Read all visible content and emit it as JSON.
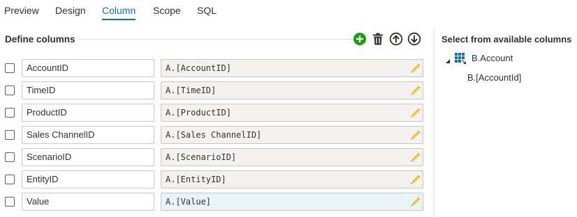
{
  "tabs": [
    {
      "label": "Preview"
    },
    {
      "label": "Design"
    },
    {
      "label": "Column",
      "active": true
    },
    {
      "label": "Scope"
    },
    {
      "label": "SQL"
    }
  ],
  "define": {
    "title": "Define columns",
    "toolbar": {
      "add_icon": "add-circle-icon",
      "delete_icon": "trash-icon",
      "move_up_icon": "arrow-up-circle-icon",
      "move_down_icon": "arrow-down-circle-icon"
    },
    "rows": [
      {
        "name": "AccountID",
        "expression": "A.[AccountID]"
      },
      {
        "name": "TimeID",
        "expression": "A.[TimeID]"
      },
      {
        "name": "ProductID",
        "expression": "A.[ProductID]"
      },
      {
        "name": "Sales ChannelID",
        "expression": "A.[Sales ChannelID]"
      },
      {
        "name": "ScenarioID",
        "expression": "A.[ScenarioID]"
      },
      {
        "name": "EntityID",
        "expression": "A.[EntityID]"
      },
      {
        "name": "Value",
        "expression": "A.[Value]",
        "selected": true
      }
    ]
  },
  "available": {
    "title": "Select from available columns",
    "tree": {
      "label": "B.Account",
      "expanded": true,
      "children": [
        {
          "label": "B.[AccountId]"
        }
      ]
    }
  },
  "colors": {
    "accent": "#0f6cbd",
    "add_green": "#13a10e",
    "pencil_yellow": "#f2c811",
    "selected_field": "#e8f4f8",
    "field_bg": "#f3f2f1"
  }
}
